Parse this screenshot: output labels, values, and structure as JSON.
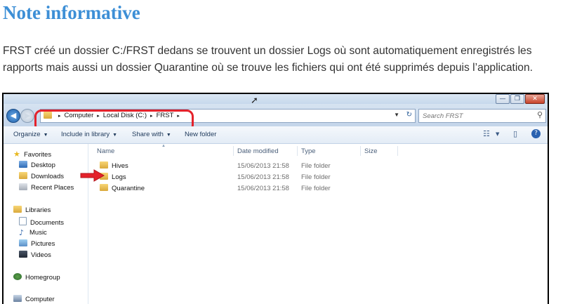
{
  "heading": "Note informative",
  "paragraph": "FRST créé un dossier C:/FRST dedans se trouvent un dossier Logs où sont automatiquement enregistrés les rapports mais aussi un dossier Quarantine où se trouve les fichiers qui ont été supprimés depuis l’application.",
  "explorer": {
    "window_buttons": {
      "minimize": "—",
      "maximize": "❐",
      "close": "✕"
    },
    "nav": {
      "back": "◀",
      "forward": "▶"
    },
    "breadcrumb": [
      "Computer",
      "Local Disk (C:)",
      "FRST"
    ],
    "breadcrumb_sep": "▸",
    "search_placeholder": "Search FRST",
    "search_icon_glyph": "⚲",
    "toolbar": {
      "organize": "Organize",
      "include_in_library": "Include in library",
      "share_with": "Share with",
      "new_folder": "New folder",
      "dropdown_glyph": "▼",
      "views_glyph": "☷",
      "preview_glyph": "▯",
      "help_glyph": "?"
    },
    "nav_pane": {
      "favorites": "Favorites",
      "desktop": "Desktop",
      "downloads": "Downloads",
      "recent_places": "Recent Places",
      "libraries": "Libraries",
      "documents": "Documents",
      "music": "Music",
      "pictures": "Pictures",
      "videos": "Videos",
      "homegroup": "Homegroup",
      "computer": "Computer"
    },
    "columns": [
      "Name",
      "Date modified",
      "Type",
      "Size"
    ],
    "files": [
      {
        "name": "Hives",
        "date": "15/06/2013 21:58",
        "type": "File folder"
      },
      {
        "name": "Logs",
        "date": "15/06/2013 21:58",
        "type": "File folder"
      },
      {
        "name": "Quarantine",
        "date": "15/06/2013 21:58",
        "type": "File folder"
      }
    ]
  },
  "colors": {
    "heading": "#3d8fd6",
    "annotation_red": "#e4222b"
  },
  "annotations": {
    "arrow_target": "Logs",
    "oval_target": "address-bar"
  }
}
